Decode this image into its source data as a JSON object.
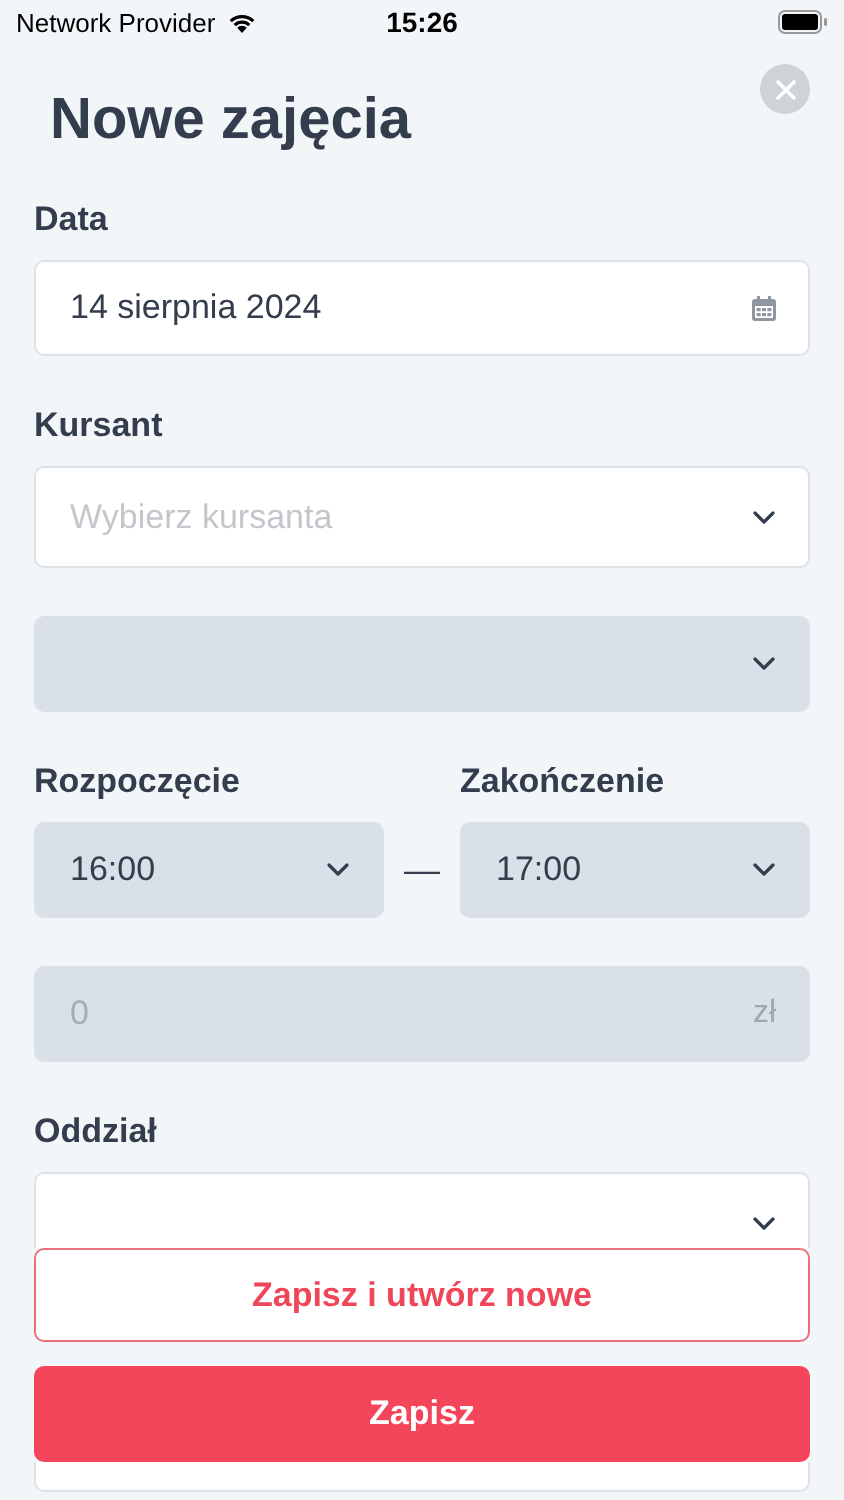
{
  "status_bar": {
    "carrier": "Network Provider",
    "time": "15:26"
  },
  "title": "Nowe zajęcia",
  "sections": [
    {
      "kind": "date",
      "label": "Data",
      "value": "14 sierpnia 2024",
      "disabled": false
    },
    {
      "kind": "select",
      "label": "Kursant",
      "placeholder": "Wybierz kursanta",
      "disabled": false
    },
    {
      "kind": "select",
      "disabled": true
    },
    {
      "kind": "time_range",
      "separator": "—",
      "start": {
        "label": "Rozpoczęcie",
        "value": "16:00",
        "disabled": true
      },
      "end": {
        "label": "Zakończenie",
        "value": "17:00",
        "disabled": true
      }
    },
    {
      "kind": "money",
      "placeholder": "0",
      "suffix": "zł",
      "disabled": true
    },
    {
      "kind": "select",
      "label": "Oddział",
      "disabled": false
    }
  ],
  "actions": [
    {
      "kind": "secondary",
      "label": "Zapisz i utwórz nowe"
    },
    {
      "kind": "primary",
      "label": "Zapisz"
    }
  ],
  "below_actions": [
    {
      "disabled": false
    }
  ]
}
